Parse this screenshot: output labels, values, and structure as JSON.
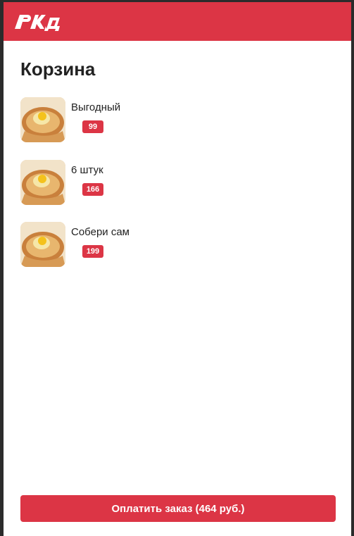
{
  "header": {
    "brand_color": "#dc3545",
    "logo_icon": "rzd-logo-icon"
  },
  "page": {
    "title": "Корзина"
  },
  "cart": {
    "items": [
      {
        "name": "Выгодный",
        "price": "99",
        "image_icon": "khachapuri-image"
      },
      {
        "name": "6 штук",
        "price": "166",
        "image_icon": "khachapuri-image"
      },
      {
        "name": "Собери сам",
        "price": "199",
        "image_icon": "khachapuri-image"
      }
    ]
  },
  "footer": {
    "pay_label": "Оплатить заказ (464 руб.)"
  }
}
